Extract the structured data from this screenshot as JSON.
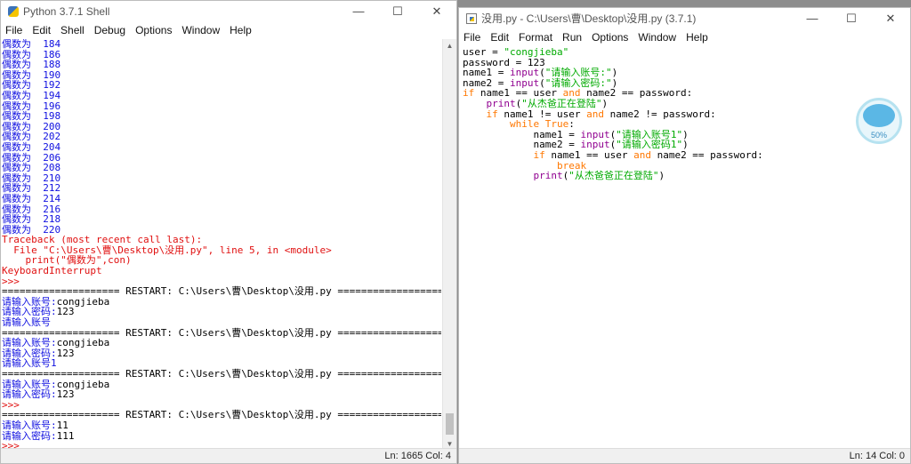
{
  "shell": {
    "title": "Python 3.7.1 Shell",
    "menu": [
      "File",
      "Edit",
      "Shell",
      "Debug",
      "Options",
      "Window",
      "Help"
    ],
    "even_label": "偶数为",
    "even_values": [
      184,
      186,
      188,
      190,
      192,
      194,
      196,
      198,
      200,
      202,
      204,
      206,
      208,
      210,
      212,
      214,
      216,
      218,
      220
    ],
    "traceback": [
      "Traceback (most recent call last):",
      "  File \"C:\\Users\\曹\\Desktop\\没用.py\", line 5, in <module>",
      "    print(\"偶数为\",con)",
      "KeyboardInterrupt"
    ],
    "prompt": ">>>",
    "restart": "==================== RESTART: C:\\Users\\曹\\Desktop\\没用.py ====================",
    "sessions": [
      [
        {
          "t": "请输入账号:",
          "v": "congjieba"
        },
        {
          "t": "请输入密码:",
          "v": "123"
        },
        {
          "t": "请输入账号",
          "v": ""
        }
      ],
      [
        {
          "t": "请输入账号:",
          "v": "congjieba"
        },
        {
          "t": "请输入密码:",
          "v": "123"
        },
        {
          "t": "请输入账号1",
          "v": ""
        }
      ],
      [
        {
          "t": "请输入账号:",
          "v": "congjieba"
        },
        {
          "t": "请输入密码:",
          "v": "123"
        }
      ],
      [
        {
          "t": "请输入账号:",
          "v": "11"
        },
        {
          "t": "请输入密码:",
          "v": "111"
        }
      ]
    ],
    "status": "Ln: 1665  Col: 4"
  },
  "editor": {
    "title": "没用.py - C:\\Users\\曹\\Desktop\\没用.py (3.7.1)",
    "menu": [
      "File",
      "Edit",
      "Format",
      "Run",
      "Options",
      "Window",
      "Help"
    ],
    "status": "Ln: 14  Col: 0"
  },
  "overlay": {
    "percent": "50%"
  }
}
